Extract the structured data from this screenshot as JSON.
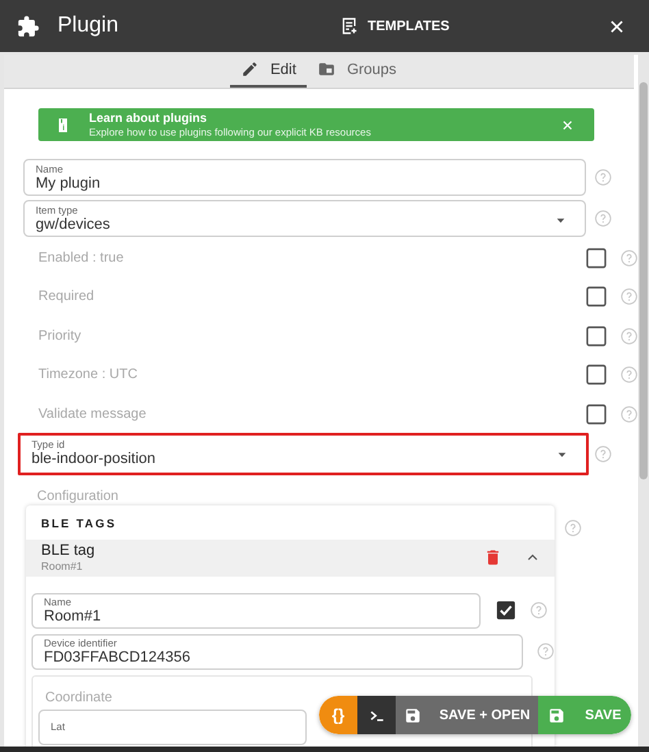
{
  "header": {
    "title": "Plugin",
    "templates_button": "TEMPLATES"
  },
  "tabs": [
    {
      "label": "Edit",
      "selected": true,
      "kind": "edit"
    },
    {
      "label": "Groups",
      "selected": false,
      "kind": "groups"
    }
  ],
  "banner": {
    "title": "Learn about plugins",
    "text": "Explore how to use plugins following our explicit KB resources"
  },
  "fields": [
    {
      "kind": "text",
      "label": "Name",
      "value": "My plugin",
      "highlighted": false
    },
    {
      "kind": "select",
      "label": "Item type",
      "value": "gw/devices",
      "highlighted": false
    },
    {
      "kind": "checkbox",
      "label": "Enabled : true",
      "checked": false
    },
    {
      "kind": "checkbox",
      "label": "Required",
      "checked": false
    },
    {
      "kind": "checkbox",
      "label": "Priority",
      "checked": false
    },
    {
      "kind": "checkbox",
      "label": "Timezone : UTC",
      "checked": false
    },
    {
      "kind": "checkbox",
      "label": "Validate message",
      "checked": false
    },
    {
      "kind": "select",
      "label": "Type id",
      "value": "ble-indoor-position",
      "highlighted": true
    }
  ],
  "configuration": {
    "label": "Configuration",
    "section_title": "BLE TAGS",
    "item": {
      "title": "BLE tag",
      "subtitle": "Room#1",
      "expanded": true,
      "fields": [
        {
          "label": "Name",
          "value": "Room#1",
          "enabled": true
        },
        {
          "label": "Device identifier",
          "value": "FD03FFABCD124356"
        }
      ],
      "coordinate": {
        "label": "Coordinate",
        "fields": [
          {
            "label": "Lat"
          }
        ]
      }
    }
  },
  "actions": [
    {
      "kind": "code",
      "label": "{}"
    },
    {
      "kind": "terminal"
    },
    {
      "kind": "save_open",
      "label": "SAVE + OPEN"
    },
    {
      "kind": "save",
      "label": "SAVE"
    }
  ]
}
